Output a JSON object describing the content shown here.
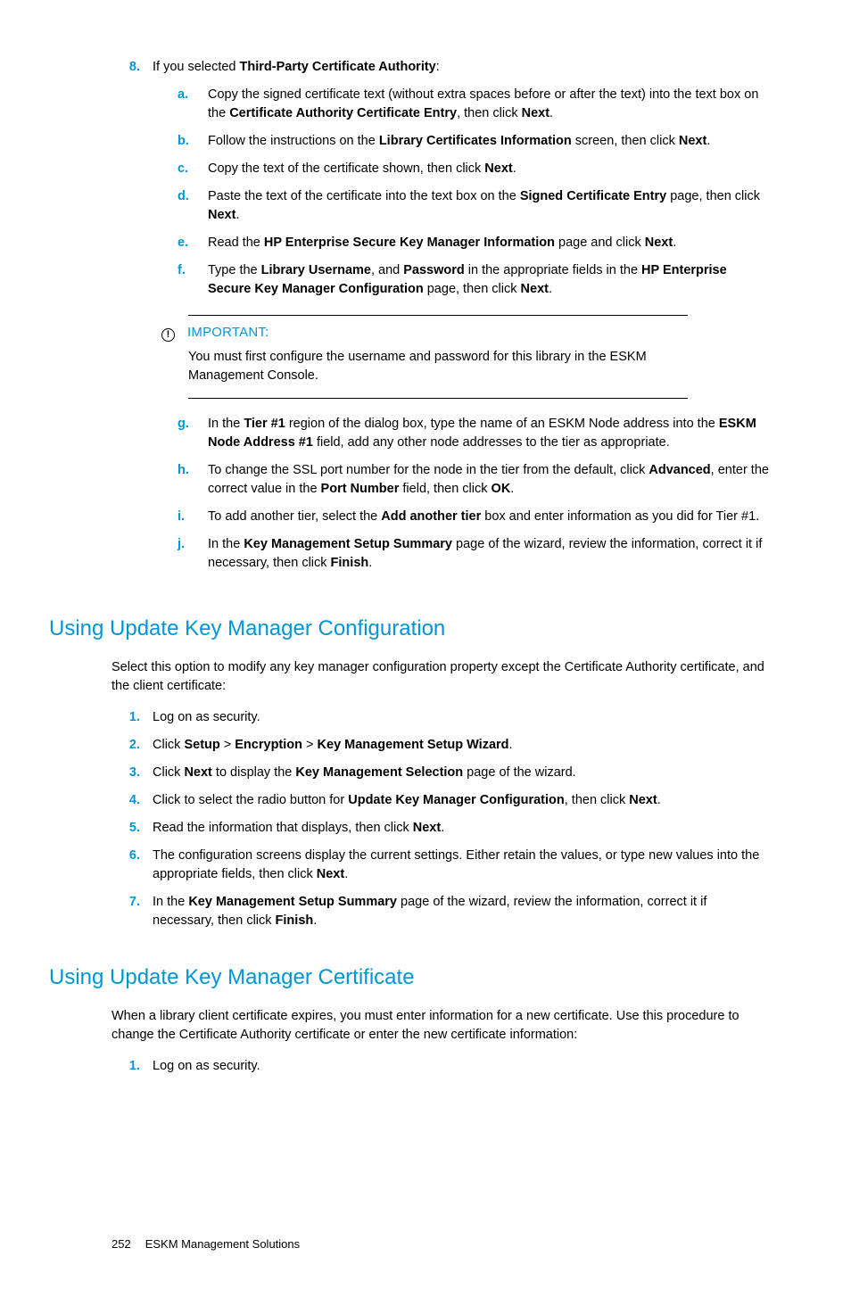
{
  "step8": {
    "marker": "8.",
    "text_pre": "If you selected ",
    "text_bold": "Third-Party Certificate Authority",
    "text_post": ":",
    "sub": {
      "a": {
        "m": "a.",
        "pre": "Copy the signed certificate text (without extra spaces before or after the text) into the text box on the ",
        "b1": "Certificate Authority Certificate Entry",
        "mid": ", then click ",
        "b2": "Next",
        "post": "."
      },
      "b": {
        "m": "b.",
        "pre": "Follow the instructions on the ",
        "b1": "Library Certificates Information",
        "mid": " screen, then click ",
        "b2": "Next",
        "post": "."
      },
      "c": {
        "m": "c.",
        "pre": "Copy the text of the certificate shown, then click ",
        "b1": "Next",
        "post": "."
      },
      "d": {
        "m": "d.",
        "pre": "Paste the text of the certificate into the text box on the ",
        "b1": "Signed Certificate Entry",
        "mid": " page, then click ",
        "b2": "Next",
        "post": "."
      },
      "e": {
        "m": "e.",
        "pre": "Read the ",
        "b1": "HP Enterprise Secure Key Manager Information",
        "mid": " page and click ",
        "b2": "Next",
        "post": "."
      },
      "f": {
        "m": "f.",
        "pre": "Type the ",
        "b1": "Library Username",
        "mid1": ", and ",
        "b2": "Password",
        "mid2": " in the appropriate fields in the ",
        "b3": "HP Enterprise Secure Key Manager Configuration",
        "mid3": " page, then click ",
        "b4": "Next",
        "post": "."
      },
      "important": {
        "label": "IMPORTANT:",
        "body": "You must first configure the username and password for this library in the ESKM Management Console."
      },
      "g": {
        "m": "g.",
        "pre": "In the ",
        "b1": "Tier #1",
        "mid1": " region of the dialog box, type the name of an ESKM Node address into the ",
        "b2": "ESKM Node Address #1",
        "mid2": " field, add any other node addresses to the tier as appropriate."
      },
      "h": {
        "m": "h.",
        "pre": "To change the SSL port number for the node in the tier from the default, click ",
        "b1": "Advanced",
        "mid1": ", enter the correct value in the ",
        "b2": "Port Number",
        "mid2": " field, then click ",
        "b3": "OK",
        "post": "."
      },
      "i": {
        "m": "i.",
        "pre": "To add another tier, select the ",
        "b1": "Add another tier",
        "post": " box and enter information as you did for Tier #1."
      },
      "j": {
        "m": "j.",
        "pre": "In the ",
        "b1": "Key Management Setup Summary",
        "mid": " page of the wizard, review the information, correct it if necessary, then click ",
        "b2": "Finish",
        "post": "."
      }
    }
  },
  "sec1": {
    "title": "Using Update Key Manager Configuration",
    "intro": "Select this option to modify any key manager configuration property except the Certificate Authority certificate, and the client certificate:",
    "steps": {
      "s1": {
        "m": "1.",
        "text": "Log on as security."
      },
      "s2": {
        "m": "2.",
        "pre": "Click ",
        "b1": "Setup",
        "mid1": " > ",
        "b2": "Encryption",
        "mid2": " > ",
        "b3": "Key Management Setup Wizard",
        "post": "."
      },
      "s3": {
        "m": "3.",
        "pre": "Click ",
        "b1": "Next",
        "mid": " to display the ",
        "b2": "Key Management Selection",
        "post": " page of the wizard."
      },
      "s4": {
        "m": "4.",
        "pre": "Click to select the radio button for ",
        "b1": "Update Key Manager Configuration",
        "mid": ", then click ",
        "b2": "Next",
        "post": "."
      },
      "s5": {
        "m": "5.",
        "pre": "Read the information that displays, then click ",
        "b1": "Next",
        "post": "."
      },
      "s6": {
        "m": "6.",
        "pre": "The configuration screens display the current settings. Either retain the values, or type new values into the appropriate fields, then click ",
        "b1": "Next",
        "post": "."
      },
      "s7": {
        "m": "7.",
        "pre": "In the ",
        "b1": "Key Management Setup Summary",
        "mid": " page of the wizard, review the information, correct it if necessary, then click ",
        "b2": "Finish",
        "post": "."
      }
    }
  },
  "sec2": {
    "title": "Using Update Key Manager Certificate",
    "intro": "When a library client certificate expires, you must enter information for a new certificate. Use this procedure to change the Certificate Authority certificate or enter the new certificate information:",
    "steps": {
      "s1": {
        "m": "1.",
        "text": "Log on as security."
      }
    }
  },
  "footer": {
    "page": "252",
    "title": "ESKM Management Solutions"
  }
}
